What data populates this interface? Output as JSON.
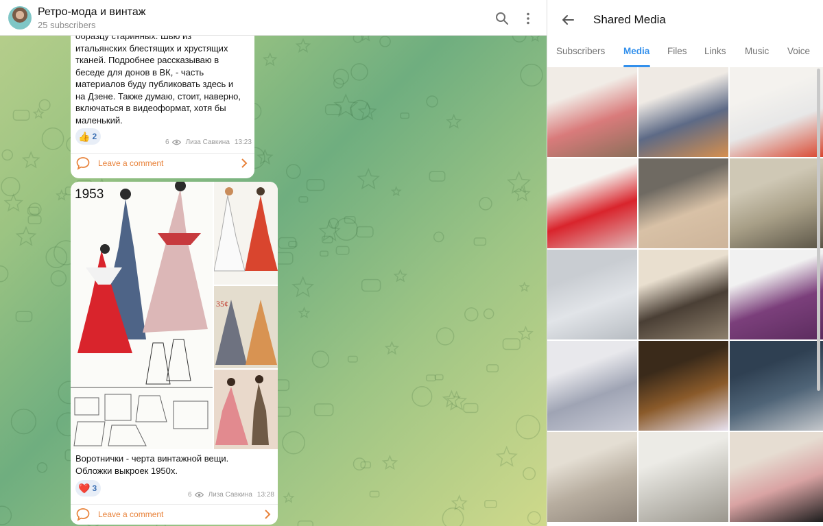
{
  "chat_header": {
    "channel_title": "Ретро-мода и винтаж",
    "subscribers": "25 subscribers"
  },
  "posts": [
    {
      "text_lines": [
        "образцу старинных. Шью из",
        "итальянских блестящих и хрустящих",
        "тканей. Подробнее рассказываю в",
        "беседе для донов в ВК, - часть",
        "материалов буду публиковать здесь и",
        "на Дзене. Также думаю, стоит, наверно,",
        "включаться в видеоформат, хотя бы",
        "маленький."
      ],
      "reaction_emoji": "👍",
      "reaction_count": "2",
      "views": "6",
      "author": "Лиза Савкина",
      "time": "13:23",
      "comment_label": "Leave a comment"
    },
    {
      "album_year_label": "1953",
      "text_lines": [
        "Воротнички - черта винтажной вещи.",
        "Обложки выкроек 1950х."
      ],
      "reaction_emoji": "❤️",
      "reaction_count": "3",
      "views": "6",
      "author": "Лиза Савкина",
      "time": "13:28",
      "comment_label": "Leave a comment"
    }
  ],
  "media_panel": {
    "title": "Shared Media",
    "tabs": [
      "Subscribers",
      "Media",
      "Files",
      "Links",
      "Music",
      "Voice"
    ],
    "active_tab": "Media"
  },
  "colors": {
    "accent": "#3390ec",
    "comment_orange": "#e8823a",
    "reaction_blue": "#3a6fb3"
  },
  "icons": {
    "search": "search-icon",
    "more": "more-vertical-icon",
    "back": "arrow-left-icon",
    "comment": "comment-bubble-icon",
    "chevron": "chevron-right-icon",
    "views": "eye-icon"
  }
}
